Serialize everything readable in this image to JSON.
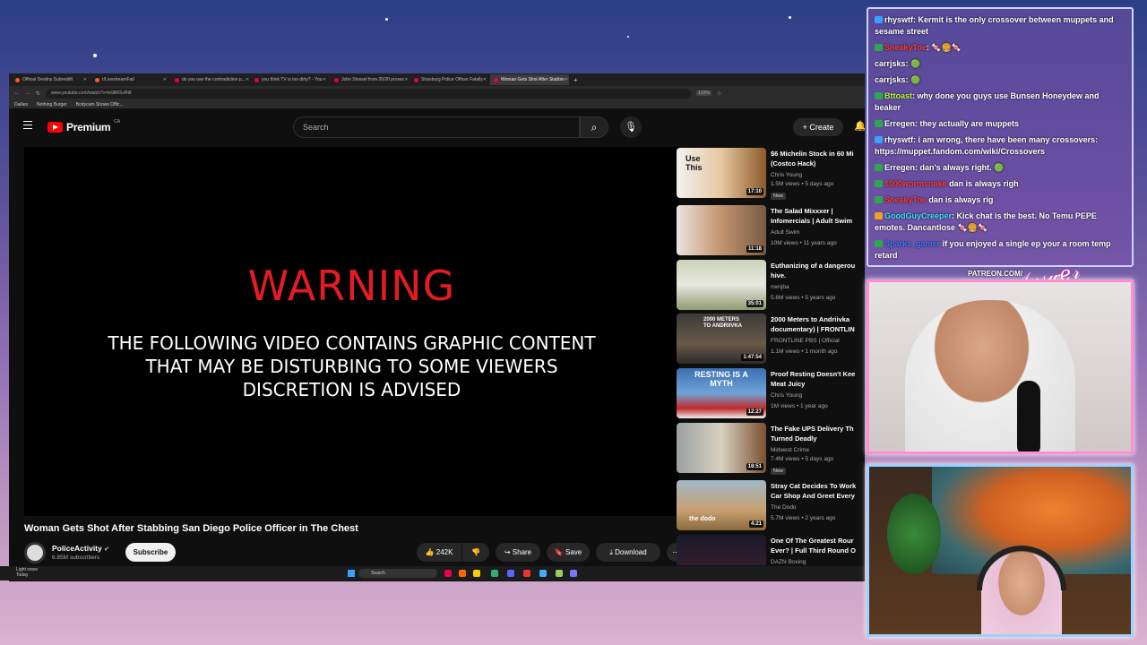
{
  "browser": {
    "tabs": [
      {
        "label": "Official Destiny Subreddit"
      },
      {
        "label": "r/LivestreamFail"
      },
      {
        "label": "do you use the contradiction p..."
      },
      {
        "label": "you think TV is too dirty? - You"
      },
      {
        "label": "John Stossel from 20/20 prosec"
      },
      {
        "label": "Strasburg Police Officer Fatally"
      },
      {
        "label": "Woman Gets Shot After Stabbin"
      }
    ],
    "url": "www.youtube.com/watch?v=ie9ltRSvRt8",
    "zoom": "120%",
    "bookmarks": [
      "Dailies",
      "Nothing Burger",
      "Bodycam Shows Offic..."
    ]
  },
  "youtube": {
    "logo_text": "Premium",
    "region": "CA",
    "search_placeholder": "Search",
    "create_label": "Create",
    "player": {
      "warning": "WARNING",
      "line1": "THE FOLLOWING VIDEO CONTAINS GRAPHIC CONTENT",
      "line2": "THAT MAY BE DISTURBING TO SOME VIEWERS",
      "line3": "DISCRETION IS ADVISED"
    },
    "video_title": "Woman Gets Shot After Stabbing San Diego Police Officer in The Chest",
    "channel": {
      "name": "PoliceActivity",
      "subscribers": "6.85M subscribers"
    },
    "subscribe_label": "Subscribe",
    "actions": {
      "likes": "242K",
      "share": "Share",
      "save": "Save",
      "download": "Download"
    },
    "recommendations": [
      {
        "title1": "$6 Michelin Stock in 60 Mi",
        "title2": "(Costco Hack)",
        "channel": "Chris Young",
        "meta": "1.5M views • 5 days ago",
        "duration": "17:10",
        "new": "New",
        "thumb_text": "Use This"
      },
      {
        "title1": "The Salad Mixxxer |",
        "title2": "Infomercials | Adult Swim",
        "channel": "Adult Swim",
        "meta": "10M views • 11 years ago",
        "duration": "11:18",
        "new": "",
        "thumb_text": ""
      },
      {
        "title1": "Euthanizing of a dangerou",
        "title2": "hive.",
        "channel": "nwnjba",
        "meta": "5.6M views • 5 years ago",
        "duration": "35:01",
        "new": "",
        "thumb_text": ""
      },
      {
        "title1": "2000 Meters to Andriivka",
        "title2": "documentary) | FRONTLIN",
        "channel": "FRONTLINE PBS | Official",
        "meta": "1.1M views • 1 month ago",
        "duration": "1:47:54",
        "new": "",
        "thumb_text": "2000 METERS TO ANDRIIVKA"
      },
      {
        "title1": "Proof Resting Doesn't Kee",
        "title2": "Meat Juicy",
        "channel": "Chris Young",
        "meta": "1M views • 1 year ago",
        "duration": "12:27",
        "new": "",
        "thumb_text": "RESTING IS A MYTH"
      },
      {
        "title1": "The Fake UPS Delivery Th",
        "title2": "Turned Deadly",
        "channel": "Midwest Crime",
        "meta": "7.4M views • 5 days ago",
        "duration": "18:51",
        "new": "New",
        "thumb_text": ""
      },
      {
        "title1": "Stray Cat Decides To Work",
        "title2": "Car Shop And Greet Every",
        "channel": "The Dodo",
        "meta": "5.7M views • 2 years ago",
        "duration": "4:21",
        "new": "",
        "thumb_text": "the dodo"
      },
      {
        "title1": "One Of The Greatest Rour",
        "title2": "Ever? | Full Third Round O",
        "channel": "DAZN Boxing",
        "meta": "",
        "duration": "",
        "new": "",
        "thumb_text": ""
      }
    ]
  },
  "taskbar": {
    "weather": "Light snow",
    "weather2": "Today",
    "search": "Search"
  },
  "chat": [
    {
      "user": "rhyswtf",
      "color": "#ffffff",
      "text": "Kermit is the only crossover between muppets and sesame street",
      "badge": "g"
    },
    {
      "user": "SneakyToe",
      "color": "#ff3b3b",
      "text": "🍬🍔🍬",
      "badge": ""
    },
    {
      "user": "carrjsks",
      "color": "#ffffff",
      "text": "🟢",
      "badge": ""
    },
    {
      "user": "carrjsks",
      "color": "#ffffff",
      "text": "🟢",
      "badge": ""
    },
    {
      "user": "Bttoast",
      "color": "#b6ff3a",
      "text": "why done you guys use Bunsen Honeydew and beaker",
      "badge": ""
    },
    {
      "user": "Erregen",
      "color": "#ffffff",
      "text": "they actually are muppets",
      "badge": ""
    },
    {
      "user": "rhyswtf",
      "color": "#ffffff",
      "text": "i am wrong, there have been many crossovers: https://muppet.fandom.com/wiki/Crossovers",
      "badge": "g"
    },
    {
      "user": "Erregen",
      "color": "#ffffff",
      "text": "dan's always right. 🟢",
      "badge": ""
    },
    {
      "user": "1000wormsnake",
      "color": "#ff3b3b",
      "text": "dan is always righ",
      "badge": ""
    },
    {
      "user": "SneakyToe",
      "color": "#ff3b3b",
      "text": "dan is always rig",
      "badge": ""
    },
    {
      "user": "GoodGuyCreeper",
      "color": "#36e0ff",
      "text": "Kick chat is the best. No Temu PEPE emotes. Dancantlose 🍬🍔🍬",
      "badge": "o"
    },
    {
      "user": "Sparks_gamer",
      "color": "#3a7bff",
      "text": "if you enjoyed a single ep your a room temp retard",
      "badge": ""
    }
  ],
  "overlay": {
    "patreon": "PATREON.COM/"
  }
}
